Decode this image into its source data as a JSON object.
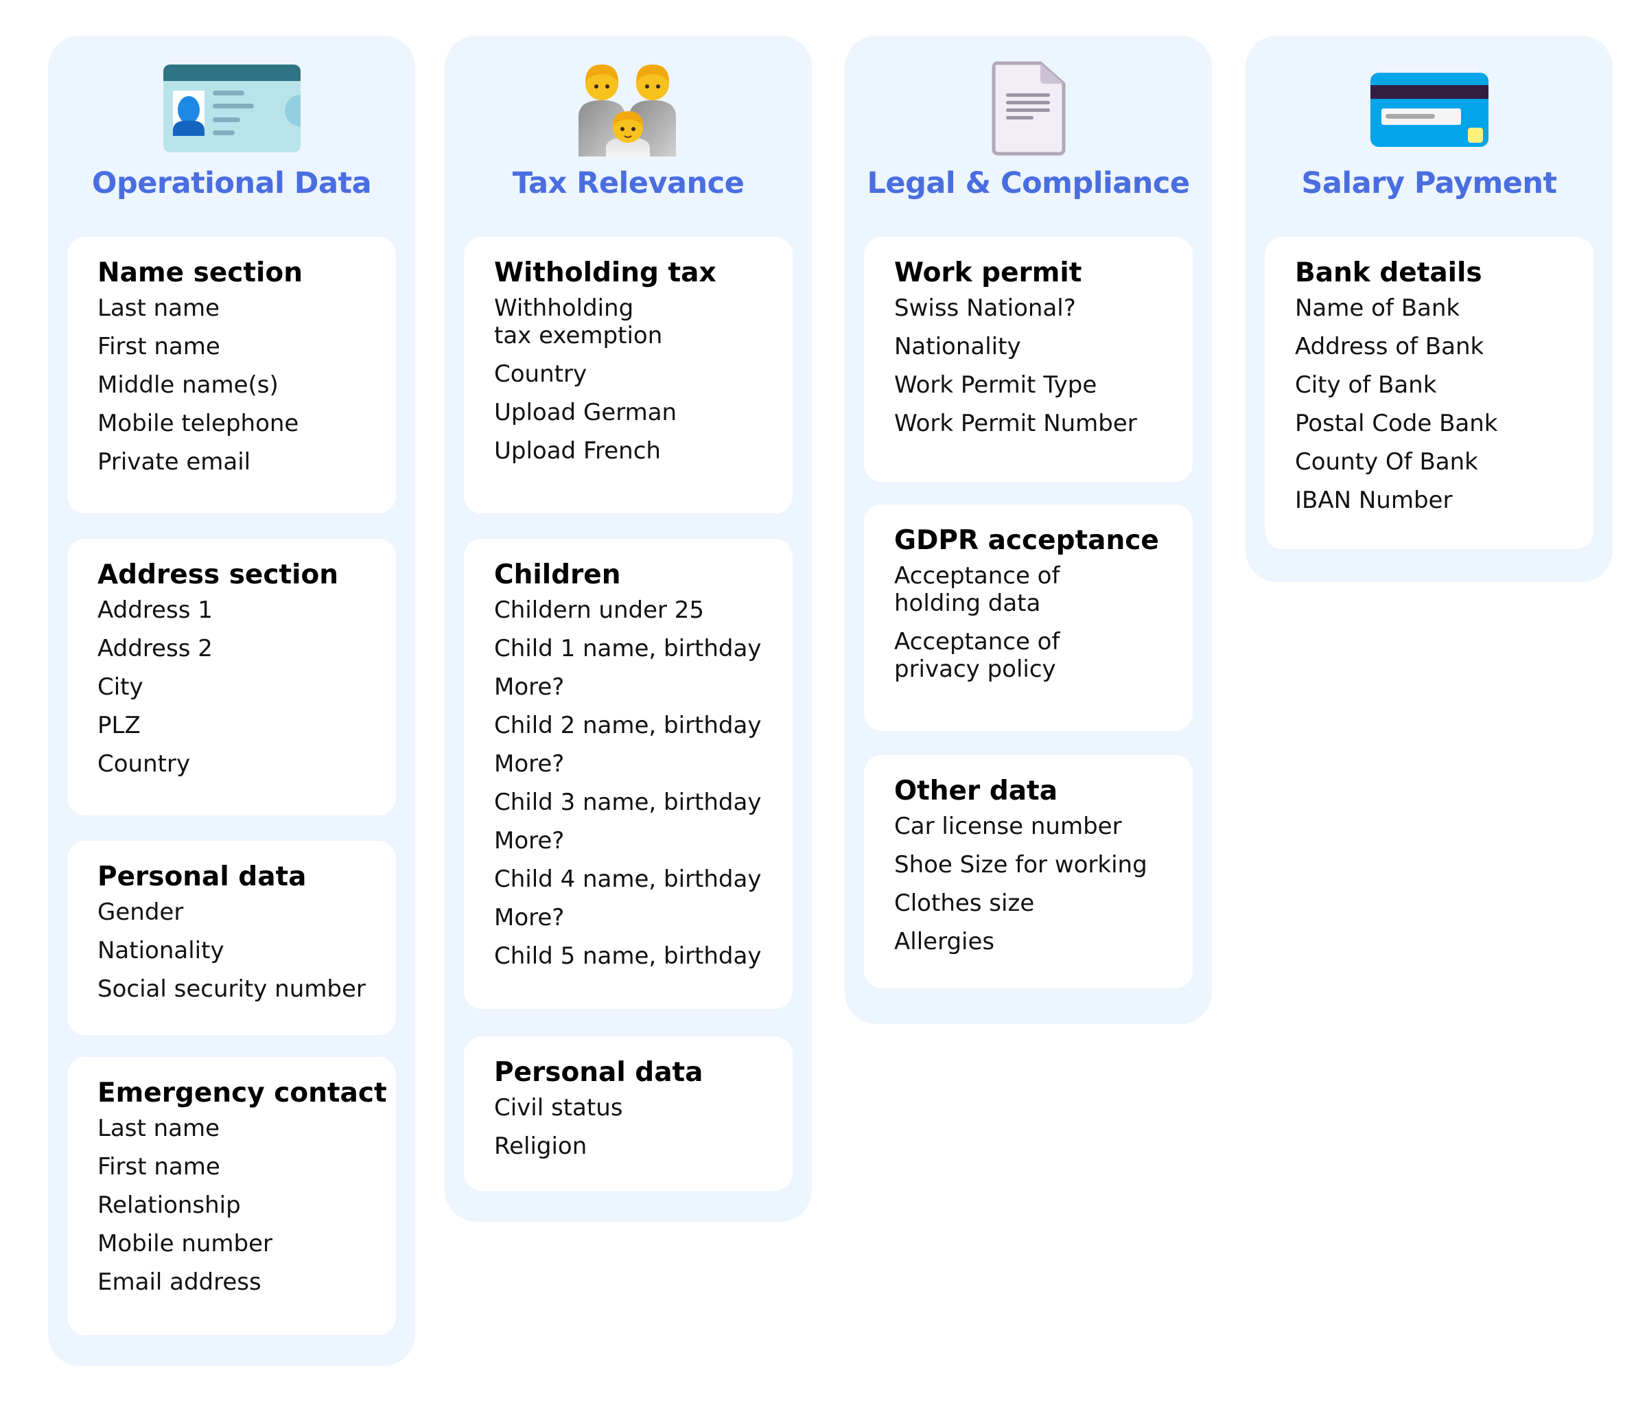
{
  "columns": [
    {
      "title": "Operational Data",
      "icon": "id-card-icon",
      "cards": [
        {
          "title": "Name section",
          "items": [
            "Last name",
            "First name",
            "Middle name(s)",
            "Mobile telephone",
            "Private email"
          ]
        },
        {
          "title": "Address section",
          "items": [
            "Address 1",
            "Address 2",
            "City",
            "PLZ",
            "Country"
          ]
        },
        {
          "title": "Personal data",
          "items": [
            "Gender",
            "Nationality",
            "Social security number"
          ]
        },
        {
          "title": "Emergency contact",
          "items": [
            "Last name",
            "First name",
            "Relationship",
            "Mobile number",
            "Email address"
          ]
        }
      ]
    },
    {
      "title": "Tax Relevance",
      "icon": "family-icon",
      "cards": [
        {
          "title": "Witholding tax",
          "items": [
            "Withholding\ntax exemption",
            "Country",
            "Upload German",
            "Upload French"
          ]
        },
        {
          "title": "Children",
          "items": [
            "Childern under 25",
            "Child 1 name, birthday",
            "More?",
            "Child 2 name, birthday",
            "More?",
            "Child 3 name, birthday",
            "More?",
            "Child 4 name, birthday",
            "More?",
            "Child 5 name, birthday"
          ]
        },
        {
          "title": "Personal data",
          "items": [
            "Civil status",
            "Religion"
          ]
        }
      ]
    },
    {
      "title": "Legal & Compliance",
      "icon": "document-icon",
      "cards": [
        {
          "title": "Work permit",
          "items": [
            "Swiss National?",
            "Nationality",
            "Work Permit Type",
            "Work Permit Number"
          ]
        },
        {
          "title": "GDPR acceptance",
          "items": [
            "Acceptance of\nholding data",
            "Acceptance of\nprivacy policy"
          ]
        },
        {
          "title": "Other data",
          "items": [
            "Car license number",
            "Shoe Size for working",
            "Clothes size",
            "Allergies"
          ]
        }
      ]
    },
    {
      "title": "Salary Payment",
      "icon": "credit-card-icon",
      "cards": [
        {
          "title": "Bank details",
          "items": [
            "Name of Bank",
            "Address of Bank",
            "City of Bank",
            "Postal Code Bank",
            "County Of Bank",
            "IBAN Number"
          ]
        }
      ]
    }
  ],
  "colors": {
    "panel_background": "#edf5fe",
    "heading_accent": "#4a6ee0",
    "card_background": "#ffffff"
  }
}
